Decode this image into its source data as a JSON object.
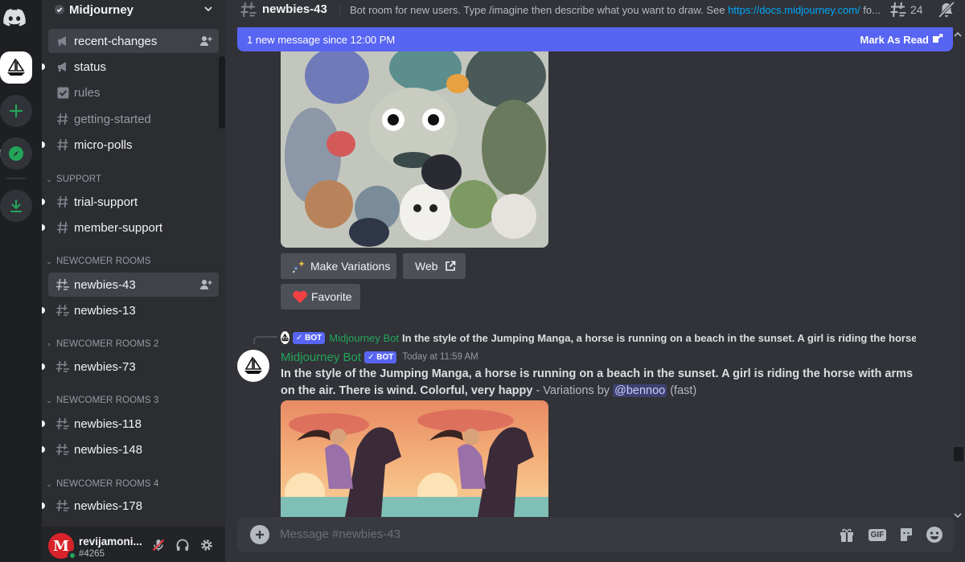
{
  "server": {
    "name": "Midjourney"
  },
  "sidebar": {
    "channels_top": [
      {
        "label": "recent-changes"
      },
      {
        "label": "status"
      },
      {
        "label": "rules"
      },
      {
        "label": "getting-started"
      },
      {
        "label": "micro-polls"
      }
    ],
    "categories": [
      {
        "label": "SUPPORT",
        "channels": [
          "trial-support",
          "member-support"
        ]
      },
      {
        "label": "NEWCOMER ROOMS",
        "channels": [
          "newbies-43",
          "newbies-13"
        ]
      },
      {
        "label": "NEWCOMER ROOMS 2",
        "channels": [
          "newbies-73"
        ]
      },
      {
        "label": "NEWCOMER ROOMS 3",
        "channels": [
          "newbies-118",
          "newbies-148"
        ]
      },
      {
        "label": "NEWCOMER ROOMS 4",
        "channels": [
          "newbies-178"
        ]
      }
    ]
  },
  "user": {
    "name": "revijamoni...",
    "tag": "#4265",
    "avatar_letter": "M"
  },
  "topbar": {
    "channel": "newbies-43",
    "topic_text": "Bot room for new users. Type /imagine then describe what you want to draw. See ",
    "topic_link": "https://docs.midjourney.com/",
    "topic_tail": " fo...",
    "thread_count": "24"
  },
  "new_messages": {
    "text": "1 new message since 12:00 PM",
    "action": "Mark As Read"
  },
  "buttons": {
    "make_variations": "Make Variations",
    "web": "Web",
    "favorite": "Favorite"
  },
  "message": {
    "reply_author": "Midjourney Bot",
    "reply_text": "In the style of the Jumping Manga, a horse is running on a beach in the sunset. A girl is riding the horse w",
    "author": "Midjourney Bot",
    "bot_tag": "BOT",
    "timestamp": "Today at 11:59 AM",
    "prompt": "In the style of the Jumping Manga, a horse is running on a beach in the sunset. A girl is riding the horse with arms on the air. There is wind. Colorful, very happy",
    "suffix": " - Variations by ",
    "mention": "@bennoo",
    "speed": " (fast)"
  },
  "composer": {
    "placeholder": "Message #newbies-43",
    "gif_label": "GIF"
  },
  "colors": {
    "blurple": "#5865f2",
    "green": "#23a55a",
    "link": "#00a8fc",
    "favorite_heart": "#f23f43"
  }
}
